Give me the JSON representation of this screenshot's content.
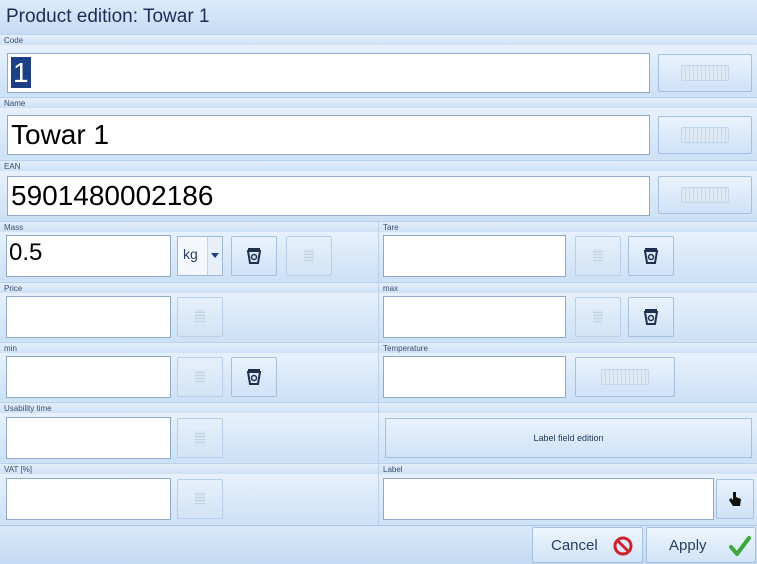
{
  "window": {
    "title": "Product edition: Towar 1"
  },
  "fields": {
    "code": {
      "label": "Code",
      "value": "1"
    },
    "name": {
      "label": "Name",
      "value": "Towar 1"
    },
    "ean": {
      "label": "EAN",
      "value": "5901480002186"
    },
    "mass": {
      "label": "Mass",
      "value": "0.5",
      "unit": "kg"
    },
    "tare": {
      "label": "Tare",
      "value": ""
    },
    "price": {
      "label": "Price",
      "value": ""
    },
    "max": {
      "label": "max",
      "value": ""
    },
    "min": {
      "label": "min",
      "value": ""
    },
    "temperature": {
      "label": "Temperature",
      "value": ""
    },
    "usability_time": {
      "label": "Usability time",
      "value": ""
    },
    "vat": {
      "label": "VAT [%]",
      "value": ""
    },
    "label": {
      "label": "Label",
      "value": ""
    }
  },
  "buttons": {
    "label_field_edition": "Label field edition",
    "cancel": "Cancel",
    "apply": "Apply"
  },
  "icons": {
    "keyboard": "keyboard-icon",
    "keypad": "keypad-icon",
    "scale": "scale-icon",
    "pointer": "hand-pointer-icon",
    "cancel": "no-entry-icon",
    "apply": "checkmark-icon"
  },
  "colors": {
    "cancel_icon": "#d0202a",
    "apply_icon": "#3aa83a",
    "selection": "#1d3f86"
  }
}
